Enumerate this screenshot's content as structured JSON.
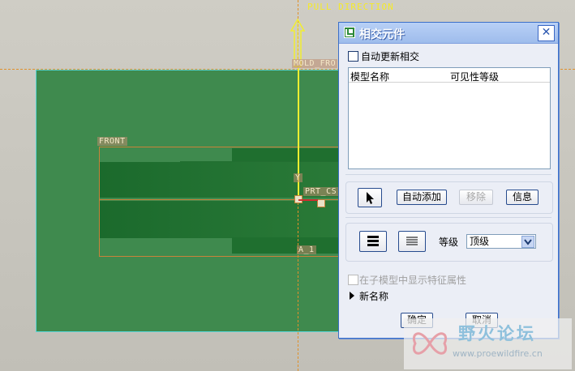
{
  "cad": {
    "pull_direction_label": "PULL DIRECTION",
    "mold_front_label": "MOLD_FRO",
    "front_label": "FRONT",
    "prt_csys_label": "PRT_CS",
    "a1_label": "A_1",
    "y_label": "Y",
    "colors": {
      "plate": "#3f8a4e",
      "part": "#1f6f2f",
      "edge": "#58d6d6",
      "axis": "#e0902a",
      "pull": "#f5ea2a"
    }
  },
  "dialog": {
    "title": "相交元件",
    "icon": "intersect-component-icon",
    "close_icon": "close-icon",
    "auto_update_label": "自动更新相交",
    "auto_update_checked": false,
    "list": {
      "columns": [
        "模型名称",
        "可见性等级"
      ],
      "rows": []
    },
    "buttons": {
      "select_icon": "cursor-arrow-icon",
      "auto_add": "自动添加",
      "remove": "移除",
      "info": "信息"
    },
    "level": {
      "icon_all": "bold-lines-icon",
      "icon_lines": "thin-lines-icon",
      "label": "等级",
      "selected": "顶级"
    },
    "show_features_label": "在子模型中显示特征属性",
    "new_name_label": "新名称",
    "ok_label": "确定",
    "cancel_label": "取消"
  },
  "watermark": {
    "brand": "野火论坛",
    "url": "www.proewildfire.cn"
  }
}
